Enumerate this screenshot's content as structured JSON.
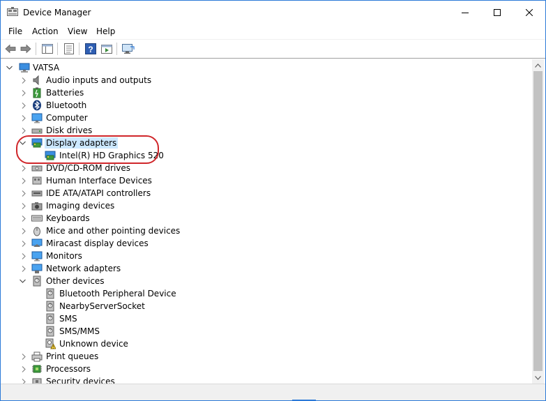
{
  "window": {
    "title": "Device Manager"
  },
  "window_buttons": {
    "minimize": "minimize",
    "maximize": "maximize",
    "close": "close"
  },
  "menu": {
    "items": [
      "File",
      "Action",
      "View",
      "Help"
    ]
  },
  "toolbar": {
    "buttons": [
      "back-icon",
      "forward-icon",
      "show-hide-tree-icon",
      "properties-icon",
      "help-icon",
      "run-icon",
      "scan-hardware-icon"
    ]
  },
  "tree": {
    "root": "VATSA",
    "categories": [
      {
        "label": "Audio inputs and outputs",
        "expanded": false
      },
      {
        "label": "Batteries",
        "expanded": false
      },
      {
        "label": "Bluetooth",
        "expanded": false
      },
      {
        "label": "Computer",
        "expanded": false
      },
      {
        "label": "Disk drives",
        "expanded": false
      },
      {
        "label": "Display adapters",
        "expanded": true,
        "selected": true,
        "children": [
          "Intel(R) HD Graphics 520"
        ]
      },
      {
        "label": "DVD/CD-ROM drives",
        "expanded": false
      },
      {
        "label": "Human Interface Devices",
        "expanded": false
      },
      {
        "label": "IDE ATA/ATAPI controllers",
        "expanded": false
      },
      {
        "label": "Imaging devices",
        "expanded": false
      },
      {
        "label": "Keyboards",
        "expanded": false
      },
      {
        "label": "Mice and other pointing devices",
        "expanded": false
      },
      {
        "label": "Miracast display devices",
        "expanded": false
      },
      {
        "label": "Monitors",
        "expanded": false
      },
      {
        "label": "Network adapters",
        "expanded": false
      },
      {
        "label": "Other devices",
        "expanded": true,
        "children": [
          "Bluetooth Peripheral Device",
          "NearbyServerSocket",
          "SMS",
          "SMS/MMS",
          "Unknown device"
        ]
      },
      {
        "label": "Print queues",
        "expanded": false
      },
      {
        "label": "Processors",
        "expanded": false
      },
      {
        "label": "Security devices",
        "expanded": false
      }
    ]
  },
  "colors": {
    "accent": "#2b79d8",
    "selection": "#cce8ff",
    "annotation": "#d0262a"
  }
}
